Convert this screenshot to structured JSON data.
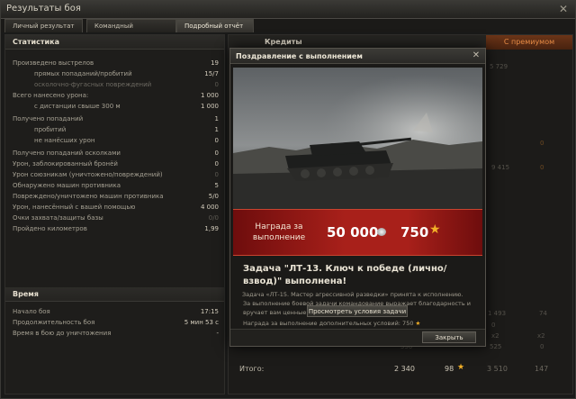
{
  "window": {
    "title": "Результаты боя",
    "close_glyph": "✕"
  },
  "tabs": [
    {
      "label": "Личный результат"
    },
    {
      "label": "Командный результат"
    },
    {
      "label": "Подробный отчёт"
    }
  ],
  "stats": {
    "header": "Статистика",
    "rows": [
      {
        "label": "Произведено выстрелов",
        "value": "19"
      },
      {
        "label": "прямых попаданий/пробитий",
        "value": "15/7"
      },
      {
        "label": "осколочно-фугасных повреждений",
        "value": "0"
      },
      {
        "label": "Всего нанесено урона:",
        "value": "1 000"
      },
      {
        "label": "с дистанции свыше 300 м",
        "value": "1 000"
      },
      {
        "label": "Получено попаданий",
        "value": "1"
      },
      {
        "label": "пробитий",
        "value": "1"
      },
      {
        "label": "не нанёсших урон",
        "value": "0"
      },
      {
        "label": "Получено попаданий осколками",
        "value": "0"
      },
      {
        "label": "Урон, заблокированный бронёй",
        "value": "0"
      },
      {
        "label": "Урон союзникам (уничтожено/повреждений)",
        "value": "0"
      },
      {
        "label": "Обнаружено машин противника",
        "value": "5"
      },
      {
        "label": "Повреждено/уничтожено машин противника",
        "value": "5/0"
      },
      {
        "label": "Урон, нанесённый с вашей помощью",
        "value": "4 000"
      },
      {
        "label": "Очки захвата/защиты базы",
        "value": "0/0"
      },
      {
        "label": "Пройдено километров",
        "value": "1,99"
      }
    ]
  },
  "time": {
    "header": "Время",
    "rows": [
      {
        "label": "Начало боя",
        "value": "17:15"
      },
      {
        "label": "Продолжительность боя",
        "value": "5 мин 53 с"
      },
      {
        "label": "Время в бою до уничтожения",
        "value": "-"
      }
    ]
  },
  "right": {
    "credits_header": "Кредиты",
    "premium_tab": "С премиумом",
    "bg_numbers": {
      "n1": "5 729",
      "n2": "0",
      "n3": "9 415",
      "n4": "0",
      "n5": "1 493",
      "n6": "74",
      "n7": "0",
      "n8": "x2",
      "n9": "x2",
      "n10": "525",
      "n11": "0",
      "n12": "550"
    },
    "total_label": "Итого:",
    "total_credits": "2 340",
    "total_xp": "98",
    "total_premium_credits": "3 510",
    "total_premium_xp": "147"
  },
  "modal": {
    "title": "Поздравление с выполнением",
    "close_glyph": "✕",
    "reward_label": "Награда за выполнение",
    "reward_credits": "50 000",
    "reward_xp": "750",
    "task_title": "Задача \"ЛТ-13. Ключ к победе (лично/взвод)\" выполнена!",
    "desc1": "За выполнение боевой задачи командование выражает благодарность и вручает вам ценные награды.",
    "desc2_prefix": "Награда за выполнение дополнительных условий: 750",
    "desc3": "Задача «ЛТ-15. Мастер агрессивной разведки» принята к исполнению.",
    "view_button": "Просмотреть условия задачи",
    "close_button": "Закрыть"
  },
  "colors": {
    "accent_red": "#a8201a",
    "star_gold": "#f2b028",
    "premium_orange": "#e48a45"
  }
}
